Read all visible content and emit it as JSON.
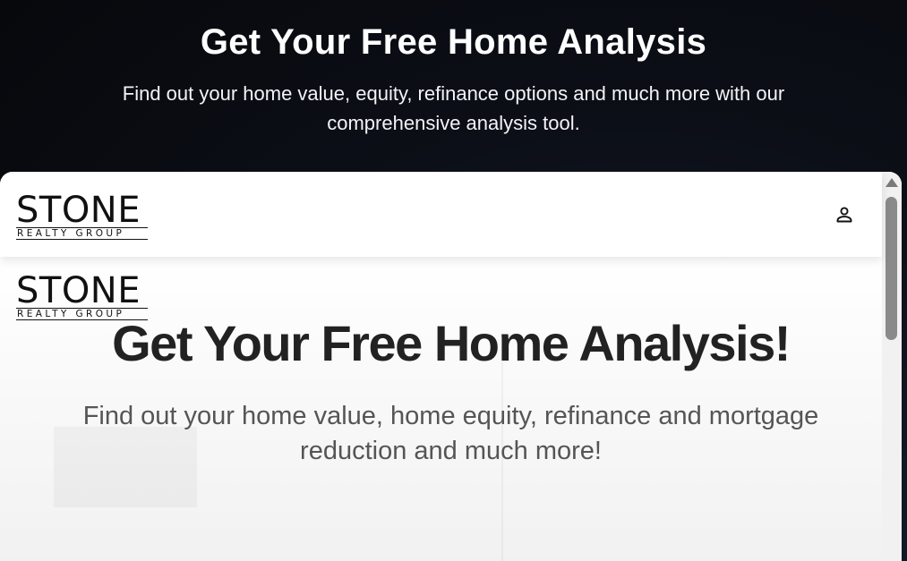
{
  "header": {
    "title": "Get Your Free Home Analysis",
    "subtitle": "Find out your home value, equity, refinance options and much more with our comprehensive analysis tool."
  },
  "site": {
    "logo": {
      "word": "STONE",
      "tagline": "REALTY GROUP"
    },
    "account_icon": "person-outline-icon"
  },
  "main": {
    "heading": "Get Your Free Home Analysis!",
    "subheading": "Find out your home value, home equity, refinance and mortgage reduction and much more!"
  },
  "colors": {
    "header_background": "#0c0f17",
    "heading_text": "#222222",
    "subheading_text": "#555555"
  }
}
